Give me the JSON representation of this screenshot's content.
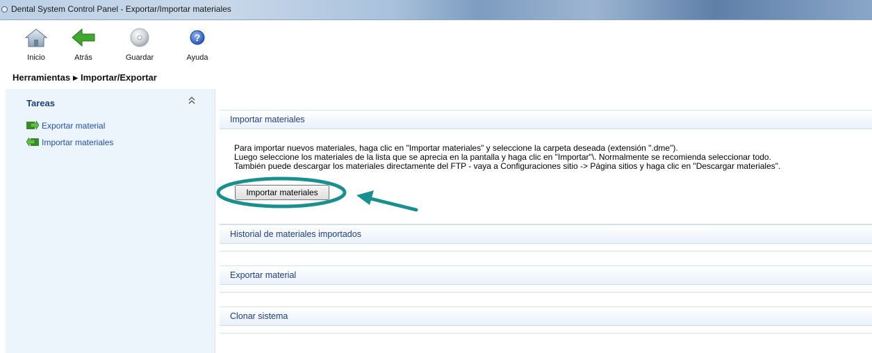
{
  "window": {
    "title": "Dental System Control Panel - Exportar/Importar materiales"
  },
  "toolbar": {
    "items": [
      {
        "label": "Inicio",
        "icon": "home-icon"
      },
      {
        "label": "Atrás",
        "icon": "back-arrow-icon"
      },
      {
        "label": "Guardar",
        "icon": "disc-icon"
      },
      {
        "label": "Ayuda",
        "icon": "help-icon"
      }
    ]
  },
  "breadcrumb": {
    "parent": "Herramientas",
    "current": "Importar/Exportar"
  },
  "sidebar": {
    "title": "Tareas",
    "items": [
      {
        "label": "Exportar material",
        "icon": "export-icon"
      },
      {
        "label": "Importar materiales",
        "icon": "import-icon"
      }
    ]
  },
  "sections": {
    "import": {
      "title": "Importar materiales",
      "lines": [
        "Para importar nuevos materiales, haga clic en \"Importar materiales\" y seleccione la carpeta deseada (extensión \".dme\").",
        "Luego seleccione los materiales de la lista que se aprecia en la pantalla y haga clic en \"Importar\"\\. Normalmente se recomienda seleccionar todo.",
        "También puede descargar los materiales directamente del FTP - vaya a Configuraciones sitio -> Página sitios y haga clic en \"Descargar materiales\"."
      ],
      "button_label": "Importar materiales"
    },
    "history": {
      "title": "Historial de materiales importados"
    },
    "export": {
      "title": "Exportar material"
    },
    "clone": {
      "title": "Clonar sistema"
    }
  },
  "colors": {
    "annotation": "#1a8f8f",
    "section_title": "#1f3c82",
    "link": "#1f4fb0",
    "panel_bg": "#edf5fc"
  }
}
